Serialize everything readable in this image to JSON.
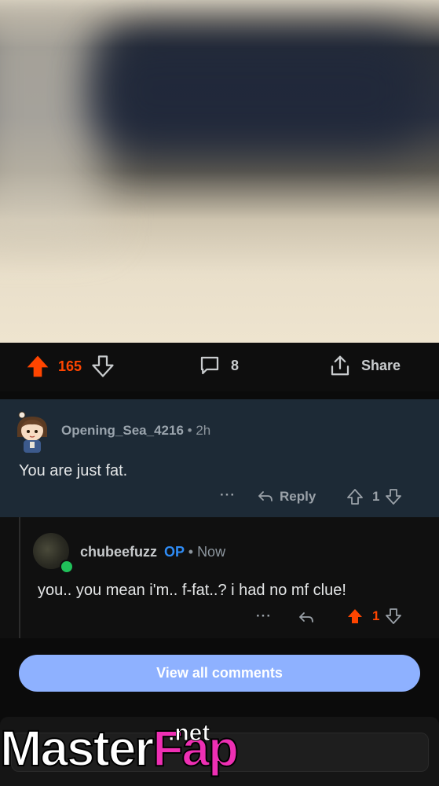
{
  "post": {
    "vote_count": "165",
    "comment_count": "8",
    "share_label": "Share"
  },
  "comments": [
    {
      "author": "Opening_Sea_4216",
      "separator": "•",
      "time": "2h",
      "body": "You are just fat.",
      "more_label": "···",
      "reply_label": "Reply",
      "score": "1"
    },
    {
      "author": "chubeefuzz",
      "op_badge": "OP",
      "separator": "•",
      "time": "Now",
      "body": "you.. you mean i'm.. f-fat..? i had no mf clue!",
      "more_label": "···",
      "score": "1"
    }
  ],
  "view_all_label": "View all comments",
  "watermark": {
    "part1": "Master",
    "part2": "Fap",
    "suffix": ".net"
  },
  "colors": {
    "upvote_active": "#ff4500",
    "op_badge": "#2f8cf5",
    "view_all_button": "#8eb1ff",
    "online_indicator": "#20c15a"
  }
}
